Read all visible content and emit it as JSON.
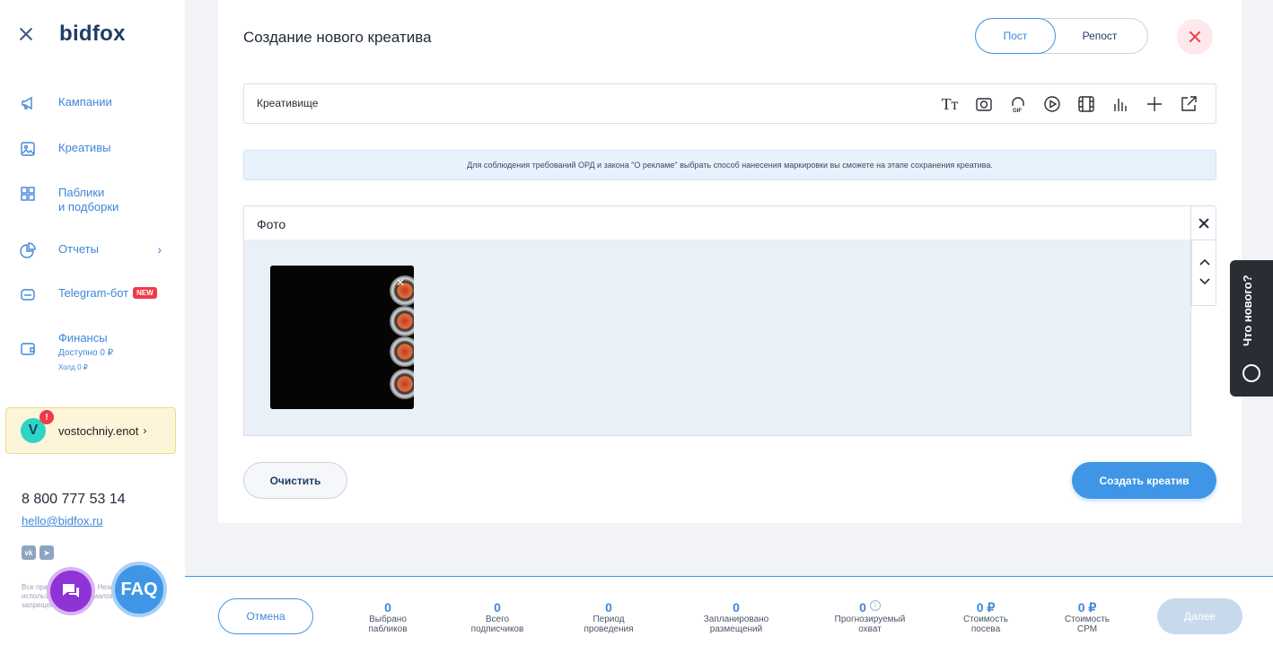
{
  "sidebar": {
    "logo": "bidfox",
    "items": [
      {
        "label": "Кампании",
        "icon": "megaphone-icon"
      },
      {
        "label": "Креативы",
        "icon": "image-icon"
      },
      {
        "label": "Паблики",
        "label2": "и подборки",
        "icon": "grid-icon"
      },
      {
        "label": "Отчеты",
        "icon": "pie-chart-icon"
      },
      {
        "label": "Telegram-бот",
        "badge": "NEW",
        "icon": "bot-icon"
      },
      {
        "label": "Финансы",
        "sub1": "Доступно 0 ₽",
        "sub2": "Холд 0 ₽",
        "icon": "wallet-icon"
      }
    ],
    "user": {
      "initial": "V",
      "name": "vostochniy.enot",
      "alert": "!"
    },
    "phone": "8 800 777 53 14",
    "email": "hello@bidfox.ru",
    "copyright": "Все права защищены. Незаконное использование материалов сайта запрещено.",
    "faq_label": "FAQ"
  },
  "editor": {
    "title": "Создание нового креатива",
    "tabs": [
      "Пост",
      "Репост"
    ],
    "name_value": "Креативище",
    "toolbar_text_icon": "Tт",
    "info": "Для соблюдения требований ОРД и закона \"О рекламе\" выбрать способ нанесения маркировки вы сможете на этапе сохранения креатива.",
    "photo_label": "Фото",
    "clear_label": "Очистить",
    "create_label": "Создать креатив"
  },
  "whats_new": "Что нового?",
  "bottom": {
    "cancel_label": "Отмена",
    "stats": [
      {
        "value": "0",
        "label1": "Выбрано",
        "label2": "пабликов"
      },
      {
        "value": "0",
        "label1": "Всего",
        "label2": "подписчиков"
      },
      {
        "value": "0",
        "label1": "Период",
        "label2": "проведения"
      },
      {
        "value": "0",
        "label1": "Запланировано",
        "label2": "размещений"
      },
      {
        "value": "0",
        "label1": "Прогнозируемый",
        "label2": "охват"
      },
      {
        "value": "0 ₽",
        "label1": "Стоимость",
        "label2": "посева"
      },
      {
        "value": "0 ₽",
        "label1": "Стоимость",
        "label2": "CPM"
      }
    ],
    "next_label": "Далее"
  },
  "colors": {
    "accent": "#3f96e6",
    "danger": "#ef3b47",
    "brand_dark": "#1f3d66"
  }
}
